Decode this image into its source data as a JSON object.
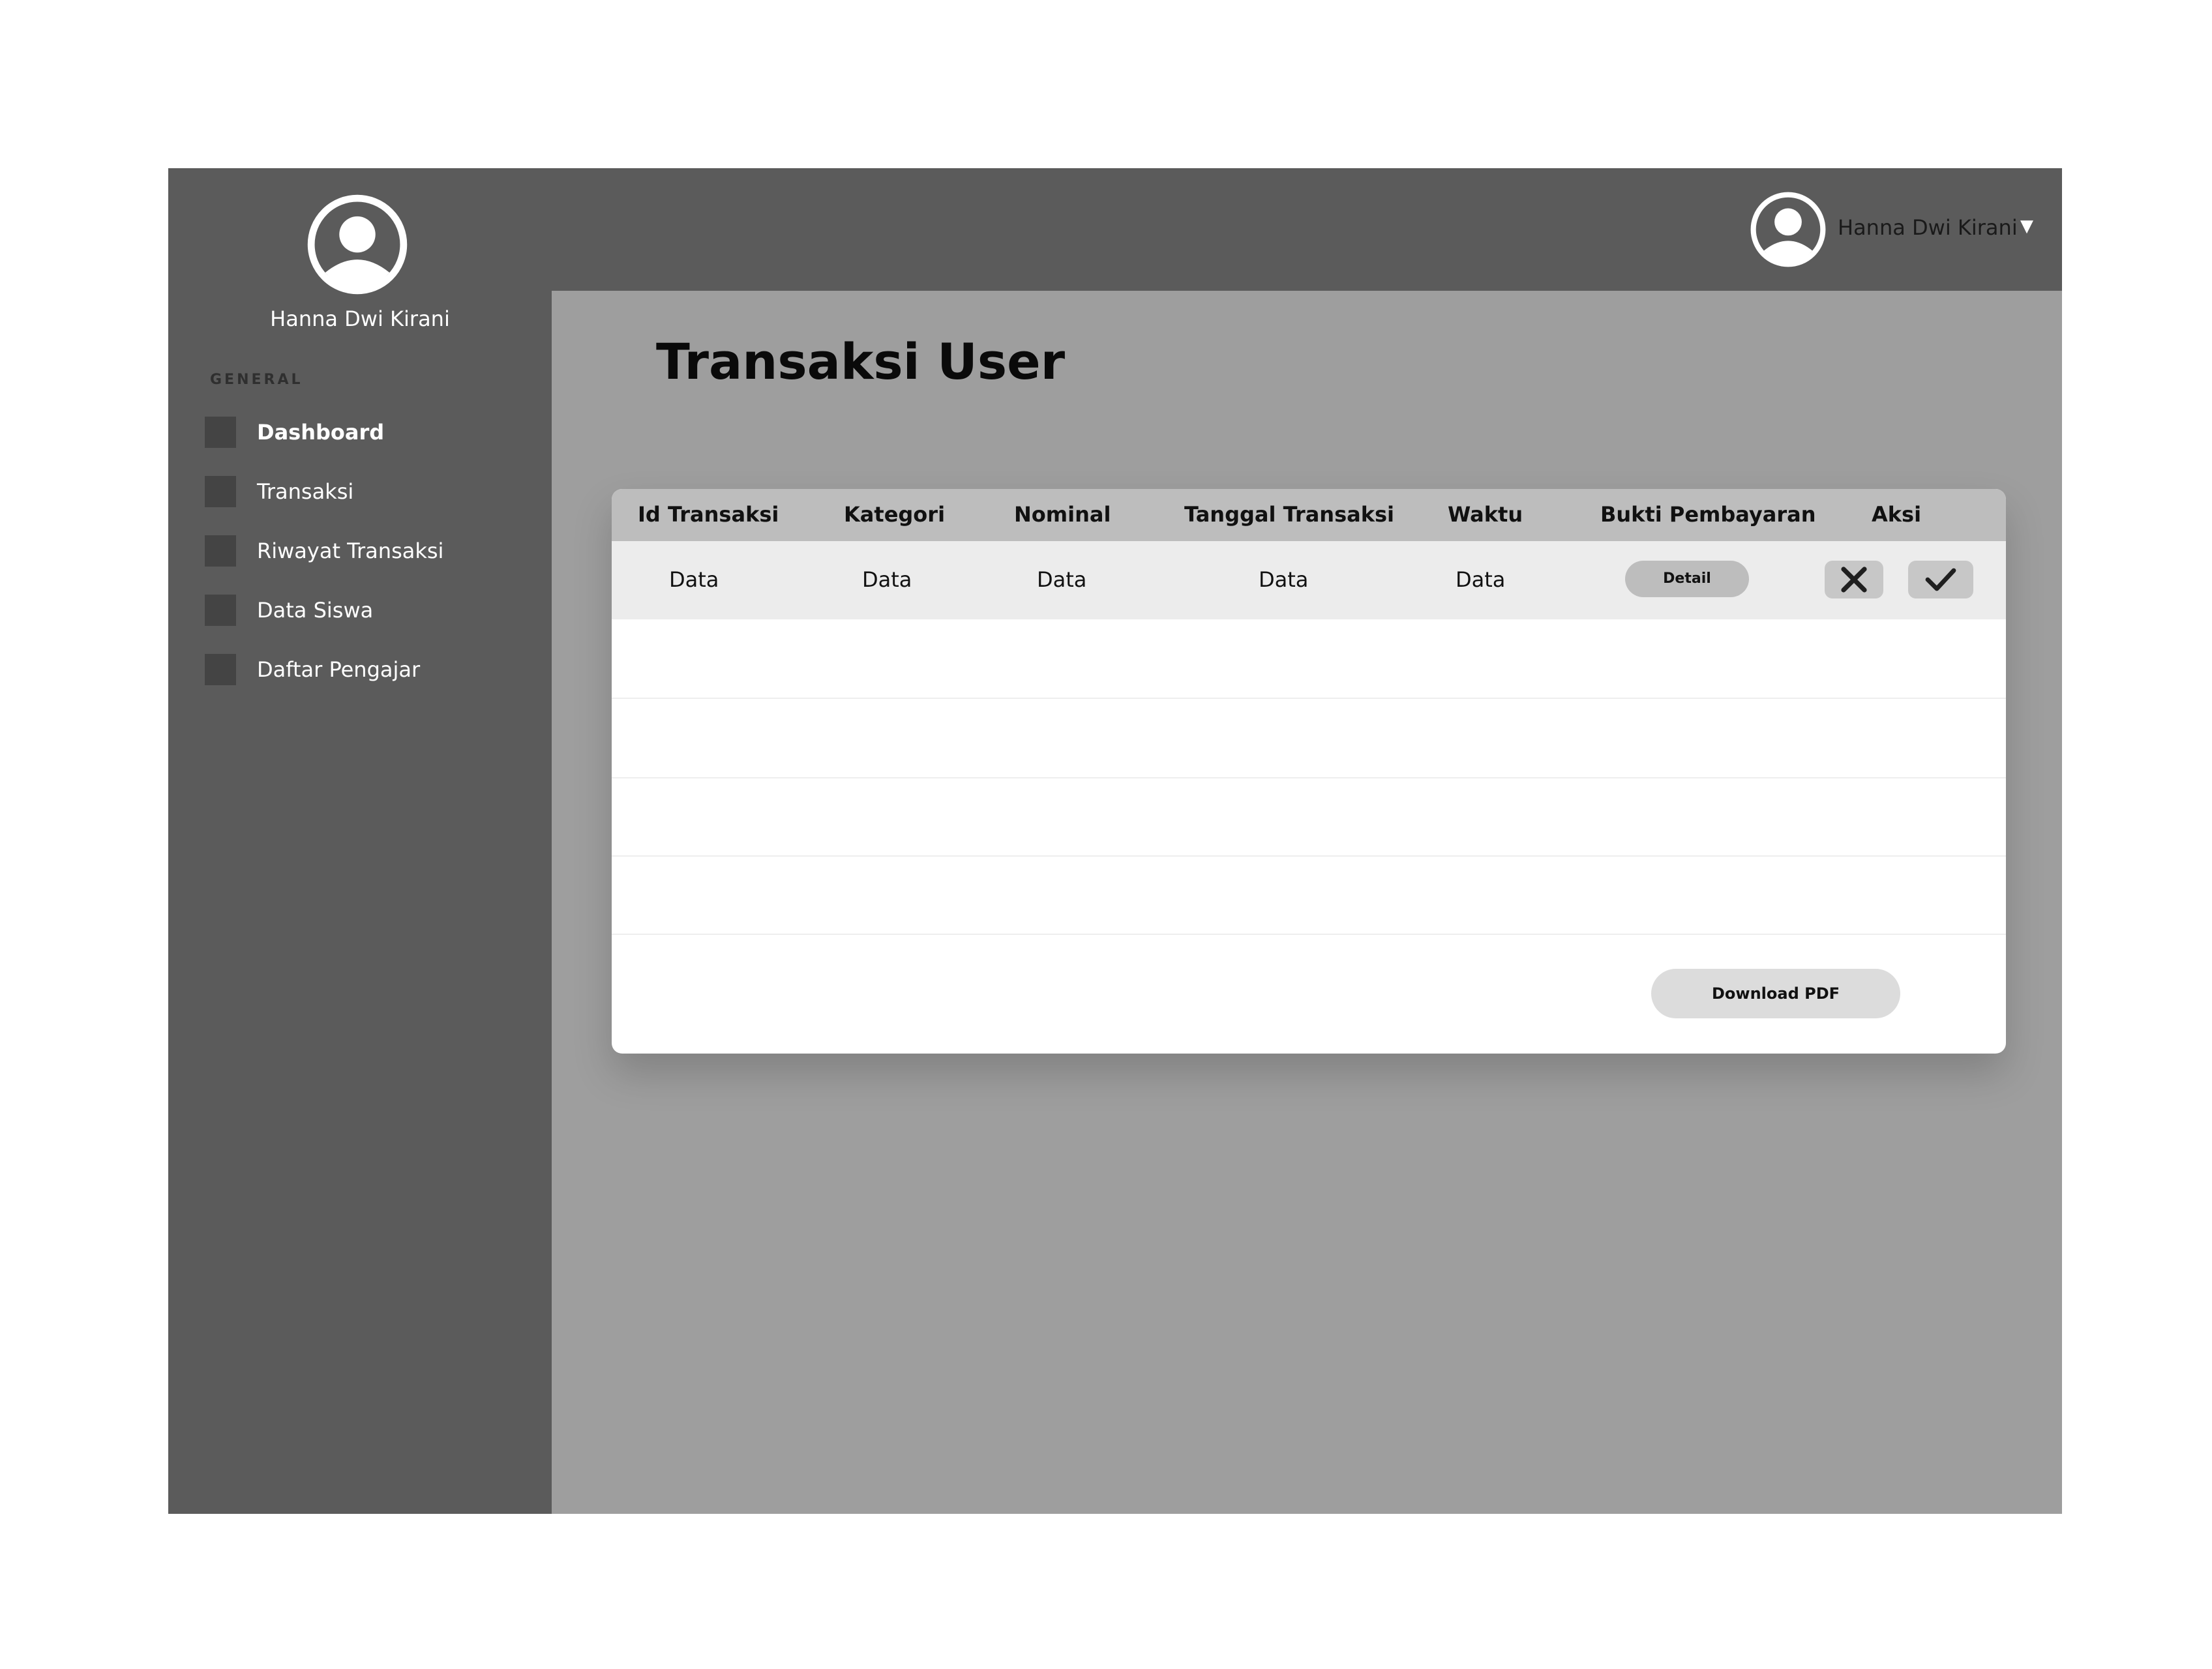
{
  "sidebar": {
    "username": "Hanna Dwi Kirani",
    "section_label": "GENERAL",
    "items": [
      {
        "label": "Dashboard",
        "icon": "square-icon"
      },
      {
        "label": "Transaksi",
        "icon": "square-icon"
      },
      {
        "label": "Riwayat Transaksi",
        "icon": "square-icon"
      },
      {
        "label": "Data Siswa",
        "icon": "square-icon"
      },
      {
        "label": "Daftar Pengajar",
        "icon": "square-icon"
      }
    ]
  },
  "topbar": {
    "username": "Hanna Dwi Kirani",
    "caret": "▼"
  },
  "main": {
    "title": "Transaksi User",
    "table": {
      "headers": [
        "Id Transaksi",
        "Kategori",
        "Nominal",
        "Tanggal Transaksi",
        "Waktu",
        "Bukti Pembayaran",
        "Aksi"
      ],
      "rows": [
        {
          "id": "Data",
          "kategori": "Data",
          "nominal": "Data",
          "tanggal": "Data",
          "waktu": "Data",
          "bukti_label": "Detail"
        }
      ]
    },
    "download_label": "Download PDF"
  },
  "colors": {
    "sidebar_bg": "#5b5b5b",
    "main_bg": "#9e9e9e",
    "header_bg": "#bdbdbd",
    "row_highlight": "#ececec"
  }
}
